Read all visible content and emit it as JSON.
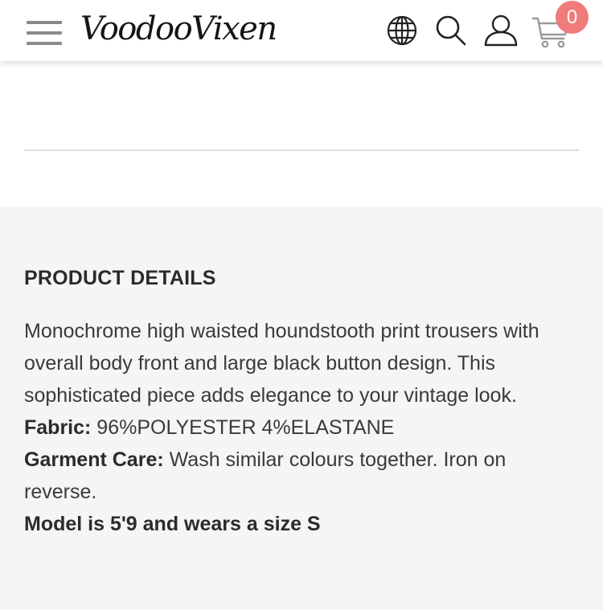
{
  "header": {
    "logo_text": "VoodooVixen",
    "icons": [
      "menu-icon",
      "globe-icon",
      "search-icon",
      "account-icon",
      "cart-icon"
    ],
    "cart_count": "0",
    "badge_color": "#f07b7b"
  },
  "product_details": {
    "title": "PRODUCT DETAILS",
    "description": "Monochrome high waisted houndstooth print trousers with overall body front and large black button design. This sophisticated piece adds elegance to your vintage look.",
    "fabric_label": "Fabric:",
    "fabric_value": " 96%POLYESTER 4%ELASTANE",
    "care_label": "Garment Care:",
    "care_value": " Wash similar colours together. Iron on reverse.",
    "model_info": "Model is 5'9 and wears a size S"
  }
}
